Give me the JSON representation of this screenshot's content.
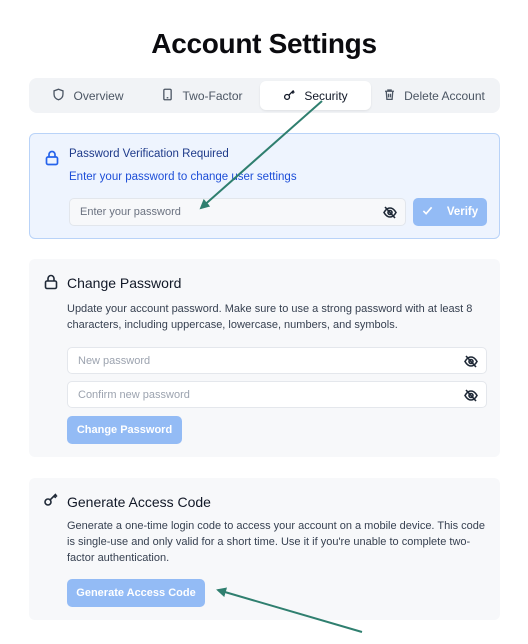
{
  "page": {
    "title": "Account Settings"
  },
  "tabs": [
    {
      "label": "Overview",
      "icon": "shield-icon"
    },
    {
      "label": "Two-Factor",
      "icon": "smartphone-icon"
    },
    {
      "label": "Security",
      "icon": "key-icon",
      "active": true
    },
    {
      "label": "Delete Account",
      "icon": "trash-icon"
    }
  ],
  "verification": {
    "title": "Password Verification Required",
    "description": "Enter your password to change user settings",
    "password_placeholder": "Enter your password",
    "verify_label": "Verify"
  },
  "change_password": {
    "title": "Change Password",
    "description": "Update your account password. Make sure to use a strong password with at least 8 characters, including uppercase, lowercase, numbers, and symbols.",
    "new_placeholder": "New password",
    "confirm_placeholder": "Confirm new password",
    "button_label": "Change Password"
  },
  "access_code": {
    "title": "Generate Access Code",
    "description": "Generate a one-time login code to access your account on a mobile device. This code is single-use and only valid for a short time. Use it if you're unable to complete two-factor authentication.",
    "button_label": "Generate Access Code"
  },
  "colors": {
    "accent": "#93bbf5",
    "info_bg": "#eef4fe",
    "info_border": "#b9d3f8",
    "annotation_arrow": "#2f7f6f"
  }
}
